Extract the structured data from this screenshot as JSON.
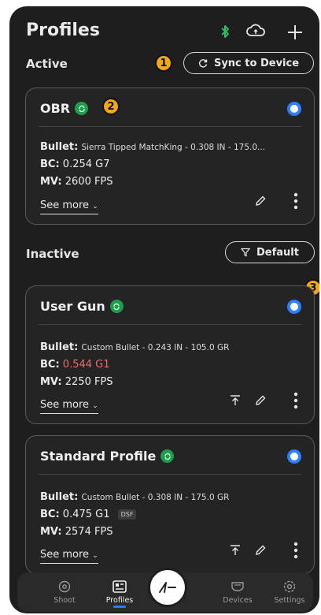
{
  "header": {
    "title": "Profiles",
    "icons": [
      "bluetooth-icon",
      "cloud-sync-icon",
      "plus-icon"
    ]
  },
  "markers": [
    "1",
    "2",
    "3"
  ],
  "active_section": {
    "label": "Active",
    "sync_button_label": "Sync to Device"
  },
  "inactive_section": {
    "label": "Inactive",
    "filter_button_label": "Default"
  },
  "profiles": [
    {
      "name": "OBR",
      "bullet_label": "Bullet:",
      "bullet_value": "Sierra Tipped MatchKing - 0.308 IN - 175.0...",
      "bc_label": "BC:",
      "bc_value": "0.254 G7",
      "mv_label": "MV:",
      "mv_value": "2600 FPS",
      "see_more": "See more"
    },
    {
      "name": "User Gun",
      "bullet_label": "Bullet:",
      "bullet_value": "Custom Bullet - 0.243 IN - 105.0 GR",
      "bc_label": "BC:",
      "bc_value": "0.544 G1",
      "mv_label": "MV:",
      "mv_value": "2250 FPS",
      "see_more": "See more"
    },
    {
      "name": "Standard Profile",
      "bullet_label": "Bullet:",
      "bullet_value": "Custom Bullet - 0.308 IN - 175.0 GR",
      "bc_label": "BC:",
      "bc_value": "0.475 G1",
      "bc_badge": "DSF",
      "mv_label": "MV:",
      "mv_value": "2574 FPS",
      "see_more": "See more"
    }
  ],
  "nav": [
    {
      "label": "Shoot",
      "icon": "crosshair-icon"
    },
    {
      "label": "Profiles",
      "icon": "profile-card-icon"
    },
    {
      "label": "Devices",
      "icon": "device-icon"
    },
    {
      "label": "Settings",
      "icon": "gear-icon"
    }
  ],
  "colors": {
    "background": "#1e1e1e",
    "accent_blue": "#2b7bff",
    "sync_green": "#1f9d4d",
    "marker_orange": "#f2a71b",
    "bc_warning_red": "#f06a6a"
  }
}
